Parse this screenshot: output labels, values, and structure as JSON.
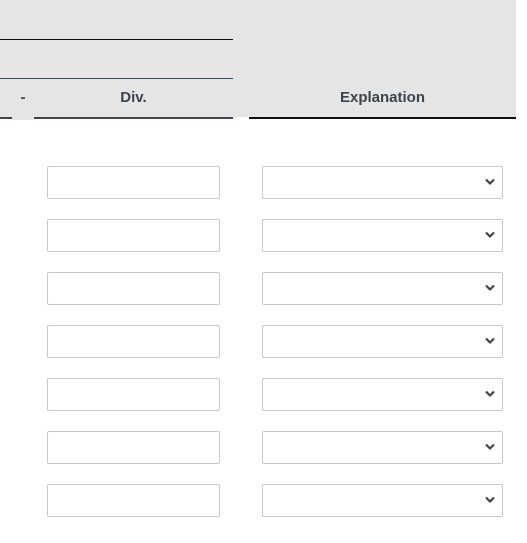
{
  "table": {
    "headers": {
      "dash": "-",
      "div": "Div.",
      "explanation": "Explanation"
    },
    "rows": [
      {
        "div_value": "",
        "explanation_value": ""
      },
      {
        "div_value": "",
        "explanation_value": ""
      },
      {
        "div_value": "",
        "explanation_value": ""
      },
      {
        "div_value": "",
        "explanation_value": ""
      },
      {
        "div_value": "",
        "explanation_value": ""
      },
      {
        "div_value": "",
        "explanation_value": ""
      },
      {
        "div_value": "",
        "explanation_value": ""
      }
    ]
  },
  "colors": {
    "header_bg": "#e5e5e5",
    "header_text": "#3b4450",
    "border": "#c8c8c8"
  }
}
